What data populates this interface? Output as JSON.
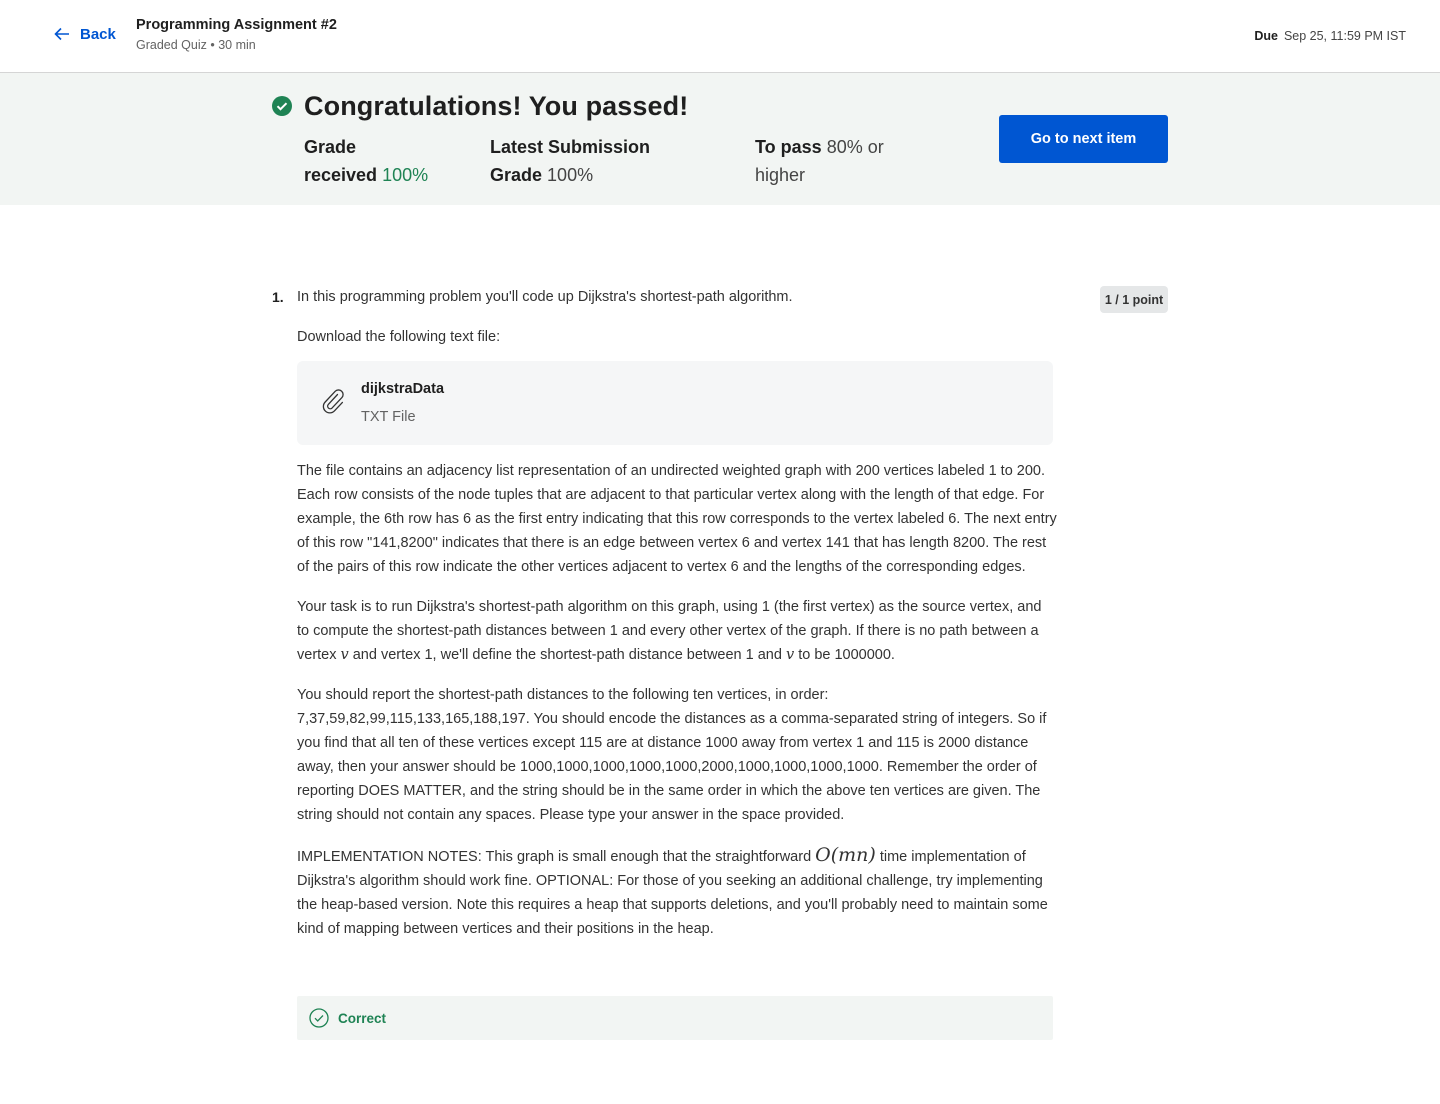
{
  "header": {
    "back_label": "Back",
    "title": "Programming Assignment #2",
    "subtitle": "Graded Quiz • 30 min",
    "due_label": "Due",
    "due_value": "Sep 25, 11:59 PM IST"
  },
  "banner": {
    "heading": "Congratulations! You passed!",
    "grade_label_line1": "Grade",
    "grade_label_line2": "received",
    "grade_value": "100%",
    "latest_label_line1": "Latest Submission",
    "latest_label_line2": "Grade",
    "latest_value": "100%",
    "pass_label": "To pass",
    "pass_value_line1": "80% or",
    "pass_value_line2": "higher",
    "next_button": "Go to next item"
  },
  "question": {
    "number": "1.",
    "points": "1 / 1 point",
    "intro": "In this programming problem you'll code up Dijkstra's shortest-path algorithm.",
    "download_prompt": "Download the following text file:",
    "file": {
      "name": "dijkstraData",
      "type": "TXT File",
      "icon": "paperclip-icon"
    },
    "para1": "The file contains an adjacency list representation of an undirected weighted graph with 200 vertices labeled 1 to 200.  Each row consists of the node tuples that are adjacent to that particular vertex along with the length of that edge. For example, the 6th row has 6 as the first entry indicating that this row corresponds to the vertex labeled 6. The next entry of this row \"141,8200\" indicates that there is an edge between vertex 6 and vertex 141 that has length 8200.  The rest of the pairs of this row indicate the other vertices adjacent to vertex 6 and the lengths of the corresponding edges.",
    "para2_a": "Your task is to run Dijkstra's shortest-path algorithm on this graph, using 1 (the first vertex) as the source vertex, and to compute the shortest-path distances between 1 and every other vertex of the graph. If there is no path between a vertex ",
    "para2_v1": "v",
    "para2_b": " and vertex 1, we'll define the shortest-path distance between 1 and ",
    "para2_v2": "v",
    "para2_c": " to be 1000000.",
    "para3": "You should report the shortest-path distances to the following ten vertices, in order: 7,37,59,82,99,115,133,165,188,197.  You should encode the distances as a comma-separated string of integers. So if you find that all ten of these vertices except 115 are at distance 1000 away from vertex 1 and 115 is 2000 distance away, then your answer should be 1000,1000,1000,1000,1000,2000,1000,1000,1000,1000. Remember the order of reporting DOES MATTER, and the string should be in the same order in which the above ten vertices are given. The string should not contain any spaces.  Please type your answer in the space provided.",
    "para4_a": "IMPLEMENTATION NOTES: This graph is small enough that the straightforward ",
    "para4_math": "O(mn)",
    "para4_b": " time implementation of Dijkstra's algorithm should work fine.  OPTIONAL: For those of you seeking an additional challenge, try implementing the heap-based version.  Note this requires a heap that supports deletions, and you'll probably need to maintain some kind of mapping between vertices and their positions in the heap.",
    "result": "Correct"
  },
  "colors": {
    "accent": "#0056d2",
    "success": "#1f8354",
    "banner_bg": "#f2f5f3"
  }
}
